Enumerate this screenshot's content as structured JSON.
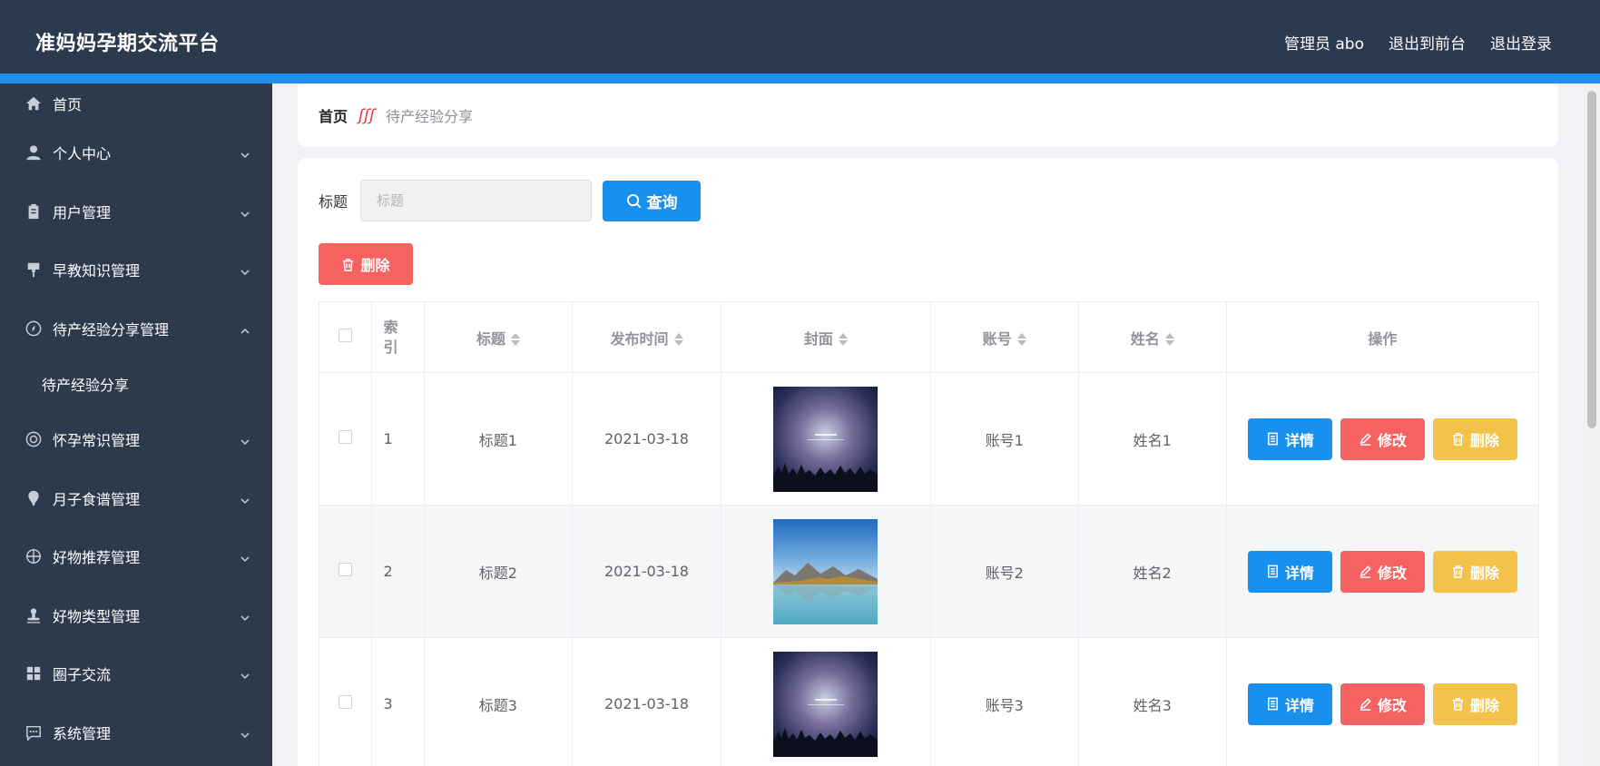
{
  "header": {
    "title": "准妈妈孕期交流平台",
    "links": [
      "管理员 abo",
      "退出到前台",
      "退出登录"
    ]
  },
  "sidebar": {
    "items": [
      {
        "label": "首页",
        "icon": "home-icon",
        "expandable": false
      },
      {
        "label": "个人中心",
        "icon": "user-icon",
        "expandable": true
      },
      {
        "label": "用户管理",
        "icon": "clipboard-icon",
        "expandable": true
      },
      {
        "label": "早教知识管理",
        "icon": "brush-icon",
        "expandable": true
      },
      {
        "label": "待产经验分享管理",
        "icon": "compass-icon",
        "expandable": true,
        "expanded": true
      },
      {
        "label": "怀孕常识管理",
        "icon": "lifebuoy-icon",
        "expandable": true
      },
      {
        "label": "月子食谱管理",
        "icon": "pin-icon",
        "expandable": true
      },
      {
        "label": "好物推荐管理",
        "icon": "crosshair-icon",
        "expandable": true
      },
      {
        "label": "好物类型管理",
        "icon": "stamp-icon",
        "expandable": true
      },
      {
        "label": "圈子交流",
        "icon": "grid-icon",
        "expandable": true
      },
      {
        "label": "系统管理",
        "icon": "chat-icon",
        "expandable": true
      }
    ],
    "submenu": {
      "label": "待产经验分享"
    }
  },
  "breadcrumb": {
    "home": "首页",
    "separator": "ʃʃʃ",
    "current": "待产经验分享"
  },
  "search": {
    "label": "标题",
    "placeholder": "标题",
    "button": "查询"
  },
  "toolbar": {
    "delete_label": "删除"
  },
  "table": {
    "headers": {
      "index": "索\n引",
      "title": "标题",
      "time": "发布时间",
      "cover": "封面",
      "account": "账号",
      "name": "姓名",
      "ops": "操作"
    },
    "rows": [
      {
        "index": "1",
        "title": "标题1",
        "time": "2021-03-18",
        "cover": "night-sky-image",
        "account": "账号1",
        "name": "姓名1"
      },
      {
        "index": "2",
        "title": "标题2",
        "time": "2021-03-18",
        "cover": "lake-mountain-image",
        "account": "账号2",
        "name": "姓名2"
      },
      {
        "index": "3",
        "title": "标题3",
        "time": "2021-03-18",
        "cover": "night-sky-image",
        "account": "账号3",
        "name": "姓名3"
      }
    ],
    "row_buttons": {
      "detail": "详情",
      "edit": "修改",
      "delete": "删除"
    }
  },
  "colors": {
    "header": "#2c3a4d",
    "accent": "#1e8ff0",
    "sidebar": "#2d3a4b",
    "danger": "#f56262",
    "warning": "#f2c24a",
    "primary": "#1890f0"
  }
}
